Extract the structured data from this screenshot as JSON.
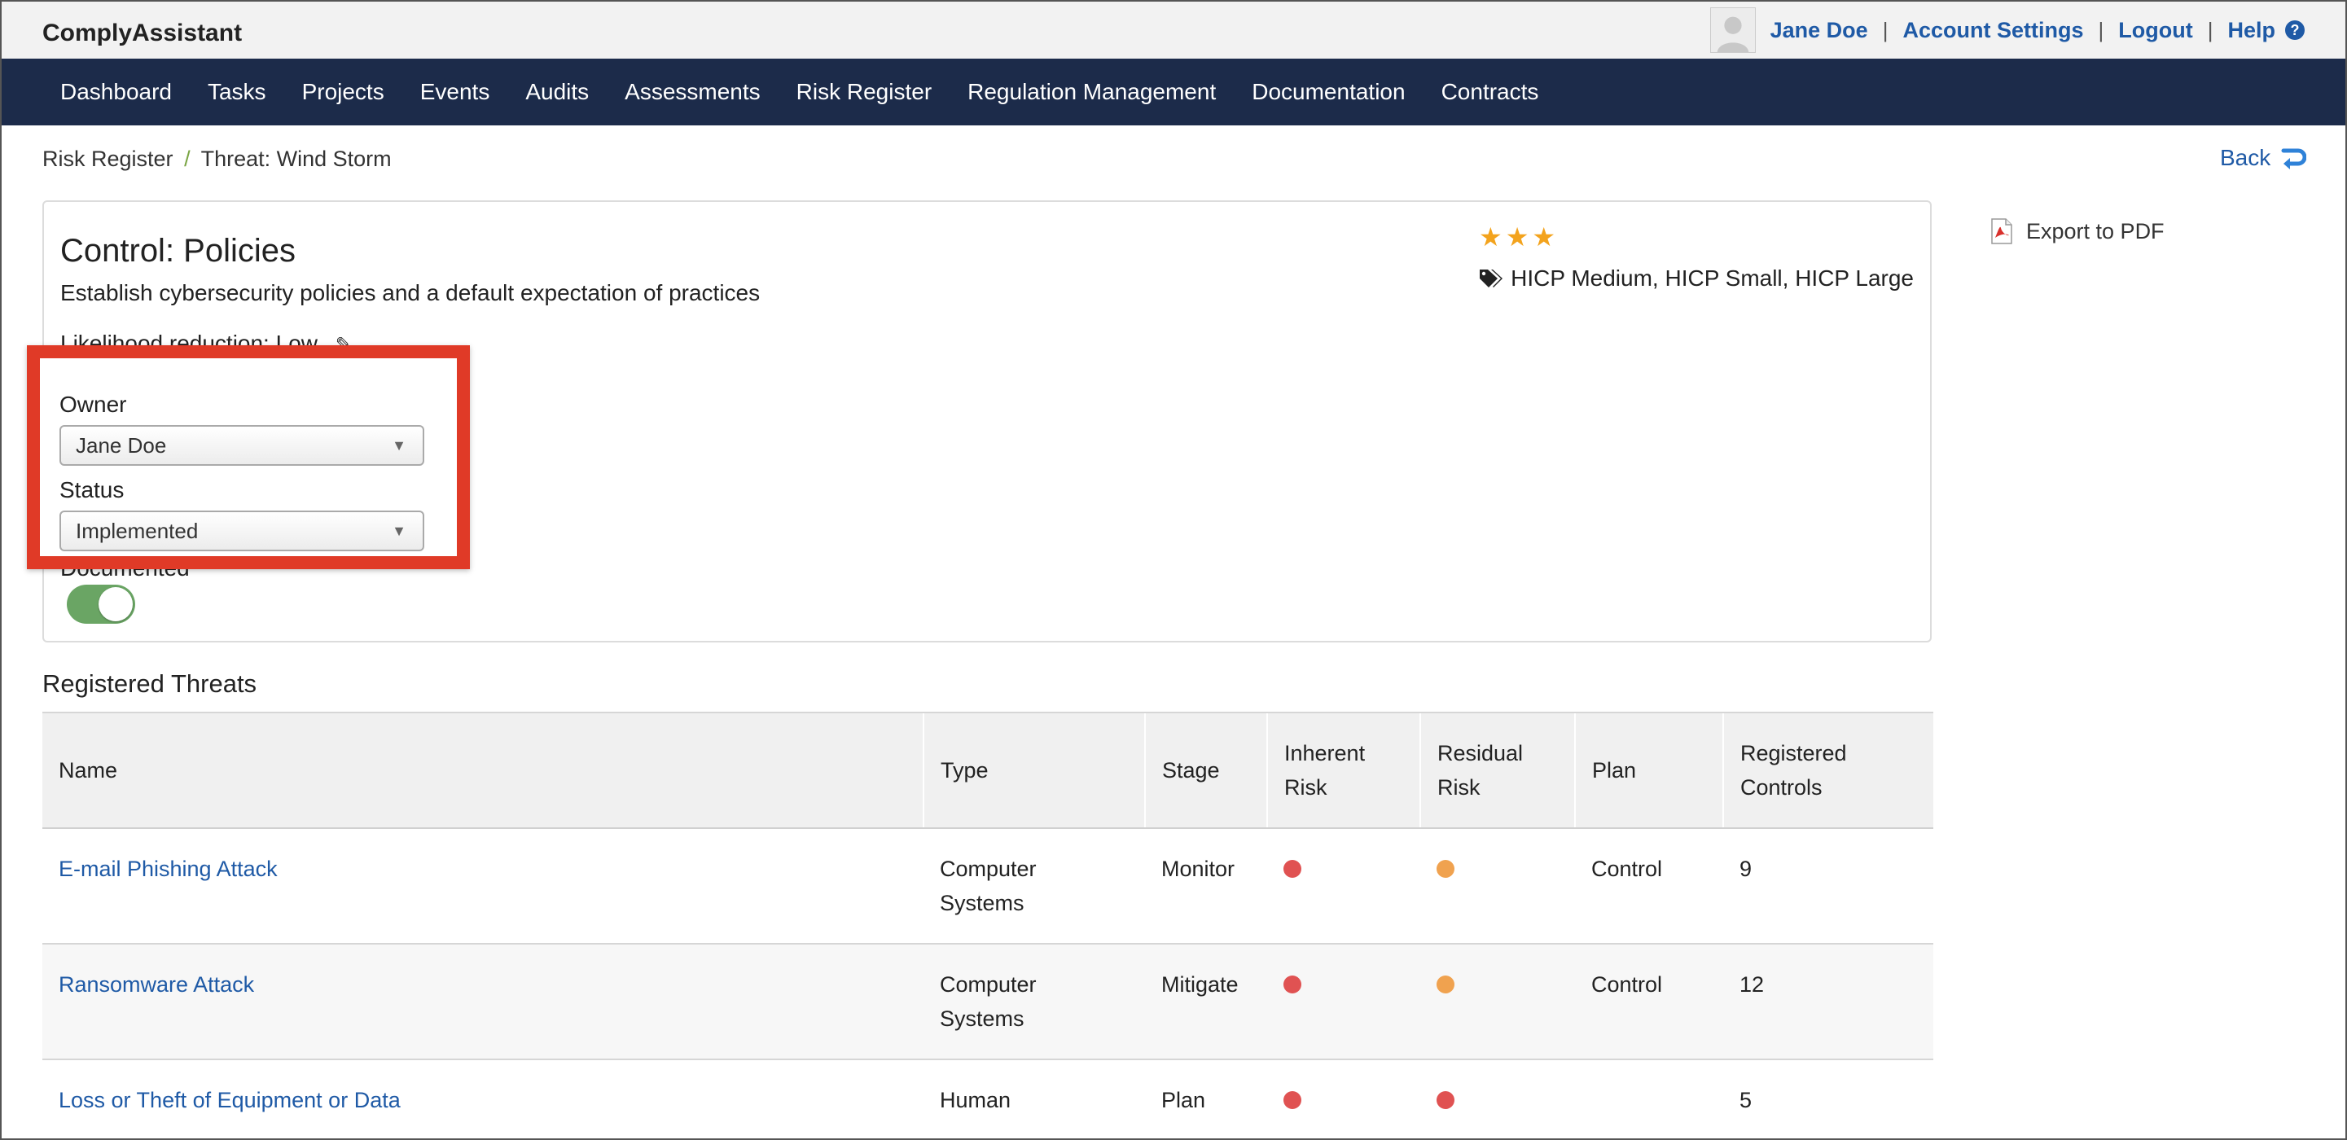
{
  "app": {
    "title": "ComplyAssistant"
  },
  "user_menu": {
    "user_name": "Jane Doe",
    "account_settings": "Account Settings",
    "logout": "Logout",
    "help": "Help",
    "separator": "|"
  },
  "nav": {
    "items": [
      "Dashboard",
      "Tasks",
      "Projects",
      "Events",
      "Audits",
      "Assessments",
      "Risk Register",
      "Regulation Management",
      "Documentation",
      "Contracts"
    ]
  },
  "breadcrumb": {
    "parent": "Risk Register",
    "separator": "/",
    "current": "Threat: Wind Storm"
  },
  "back": {
    "label": "Back"
  },
  "control": {
    "title": "Control: Policies",
    "description": "Establish cybersecurity policies and a default expectation of practices",
    "likelihood": "Likelihood reduction: Low",
    "stars": "★★★",
    "star_count": 3,
    "tags": "HICP Medium, HICP Small, HICP Large",
    "owner_label": "Owner",
    "owner_value": "Jane Doe",
    "status_label": "Status",
    "status_value": "Implemented",
    "documented_label": "Documented",
    "documented_on": true
  },
  "export": {
    "label": "Export to PDF"
  },
  "threats": {
    "title": "Registered Threats",
    "columns": {
      "name": "Name",
      "type": "Type",
      "stage": "Stage",
      "inherent_1": "Inherent",
      "inherent_2": "Risk",
      "residual_1": "Residual",
      "residual_2": "Risk",
      "plan": "Plan",
      "controls_1": "Registered",
      "controls_2": "Controls"
    },
    "rows": [
      {
        "name": "E-mail Phishing Attack",
        "type_1": "Computer",
        "type_2": "Systems",
        "stage": "Monitor",
        "inherent_color": "#e05252",
        "residual_color": "#f0a24f",
        "plan": "Control",
        "controls": "9"
      },
      {
        "name": "Ransomware Attack",
        "type_1": "Computer",
        "type_2": "Systems",
        "stage": "Mitigate",
        "inherent_color": "#e05252",
        "residual_color": "#f0a24f",
        "plan": "Control",
        "controls": "12"
      },
      {
        "name": "Loss or Theft of Equipment or Data",
        "type_1": "Human",
        "type_2": "",
        "stage": "Plan",
        "inherent_color": "#e05252",
        "residual_color": "#e05252",
        "plan": "",
        "controls": "5"
      }
    ]
  },
  "colors": {
    "nav_bg": "#1c2b4a",
    "link": "#1f5aa6",
    "highlight": "#e03a27",
    "toggle_on": "#6aa564",
    "star": "#f3a31d"
  }
}
